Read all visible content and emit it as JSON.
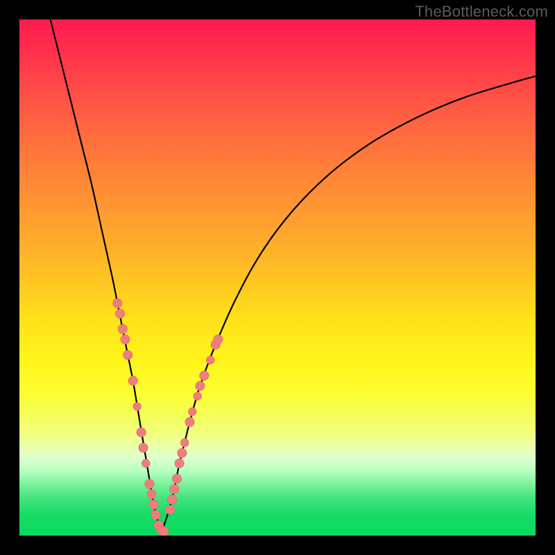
{
  "watermark": "TheBottleneck.com",
  "colors": {
    "curve": "#000000",
    "marker_fill": "#ef7d7d",
    "marker_stroke": "#d86767",
    "frame": "#000000"
  },
  "chart_data": {
    "type": "line",
    "title": "",
    "xlabel": "",
    "ylabel": "",
    "xlim": [
      0,
      100
    ],
    "ylim": [
      0,
      100
    ],
    "grid": false,
    "legend": false,
    "series": [
      {
        "name": "left-curve",
        "x": [
          6,
          8,
          10,
          12,
          14,
          16,
          18,
          19,
          20,
          21,
          22,
          23,
          24,
          25,
          25.5,
          26,
          26.5,
          27,
          27.5
        ],
        "y": [
          100,
          92,
          84,
          76,
          68,
          59,
          50,
          45,
          40,
          35,
          30,
          24,
          18,
          12,
          9,
          6,
          4,
          2.2,
          1
        ]
      },
      {
        "name": "right-curve",
        "x": [
          27.5,
          28,
          29,
          30,
          31,
          32,
          33,
          35,
          38,
          42,
          47,
          53,
          60,
          68,
          77,
          86,
          95,
          100
        ],
        "y": [
          1,
          2,
          5,
          9,
          14,
          18,
          22,
          29,
          37,
          46,
          55,
          63,
          70,
          76,
          81,
          84.8,
          87.6,
          89
        ]
      }
    ],
    "markers": [
      {
        "series": "left",
        "x": 19.0,
        "y": 45,
        "r": 1.6
      },
      {
        "series": "left",
        "x": 19.5,
        "y": 43,
        "r": 1.6
      },
      {
        "series": "left",
        "x": 20.0,
        "y": 40,
        "r": 1.6
      },
      {
        "series": "left",
        "x": 20.5,
        "y": 38,
        "r": 1.6
      },
      {
        "series": "left",
        "x": 21.0,
        "y": 35,
        "r": 1.6
      },
      {
        "series": "left",
        "x": 22.0,
        "y": 30,
        "r": 1.6
      },
      {
        "series": "left",
        "x": 22.8,
        "y": 25,
        "r": 1.4
      },
      {
        "series": "left",
        "x": 23.6,
        "y": 20,
        "r": 1.6
      },
      {
        "series": "left",
        "x": 24.0,
        "y": 17,
        "r": 1.6
      },
      {
        "series": "left",
        "x": 24.5,
        "y": 14,
        "r": 1.4
      },
      {
        "series": "left",
        "x": 25.2,
        "y": 10,
        "r": 1.6
      },
      {
        "series": "left",
        "x": 25.6,
        "y": 8,
        "r": 1.6
      },
      {
        "series": "left",
        "x": 26.0,
        "y": 6,
        "r": 1.6
      },
      {
        "series": "left",
        "x": 26.4,
        "y": 4,
        "r": 1.6
      },
      {
        "series": "left",
        "x": 27.0,
        "y": 2,
        "r": 1.6
      },
      {
        "series": "left",
        "x": 27.5,
        "y": 1,
        "r": 1.6
      },
      {
        "series": "left",
        "x": 28.0,
        "y": 0.8,
        "r": 1.6
      },
      {
        "series": "right",
        "x": 29.2,
        "y": 5,
        "r": 1.6
      },
      {
        "series": "right",
        "x": 29.6,
        "y": 7,
        "r": 1.6
      },
      {
        "series": "right",
        "x": 30.0,
        "y": 9,
        "r": 1.6
      },
      {
        "series": "right",
        "x": 30.5,
        "y": 11,
        "r": 1.6
      },
      {
        "series": "right",
        "x": 31.0,
        "y": 14,
        "r": 1.6
      },
      {
        "series": "right",
        "x": 31.5,
        "y": 16,
        "r": 1.6
      },
      {
        "series": "right",
        "x": 32.0,
        "y": 18,
        "r": 1.4
      },
      {
        "series": "right",
        "x": 33.0,
        "y": 22,
        "r": 1.6
      },
      {
        "series": "right",
        "x": 33.5,
        "y": 24,
        "r": 1.4
      },
      {
        "series": "right",
        "x": 34.5,
        "y": 27,
        "r": 1.4
      },
      {
        "series": "right",
        "x": 35.0,
        "y": 29,
        "r": 1.6
      },
      {
        "series": "right",
        "x": 35.8,
        "y": 31,
        "r": 1.6
      },
      {
        "series": "right",
        "x": 37.0,
        "y": 34,
        "r": 1.4
      },
      {
        "series": "right",
        "x": 38.0,
        "y": 37,
        "r": 1.6
      },
      {
        "series": "right",
        "x": 38.5,
        "y": 38,
        "r": 1.6
      }
    ]
  }
}
